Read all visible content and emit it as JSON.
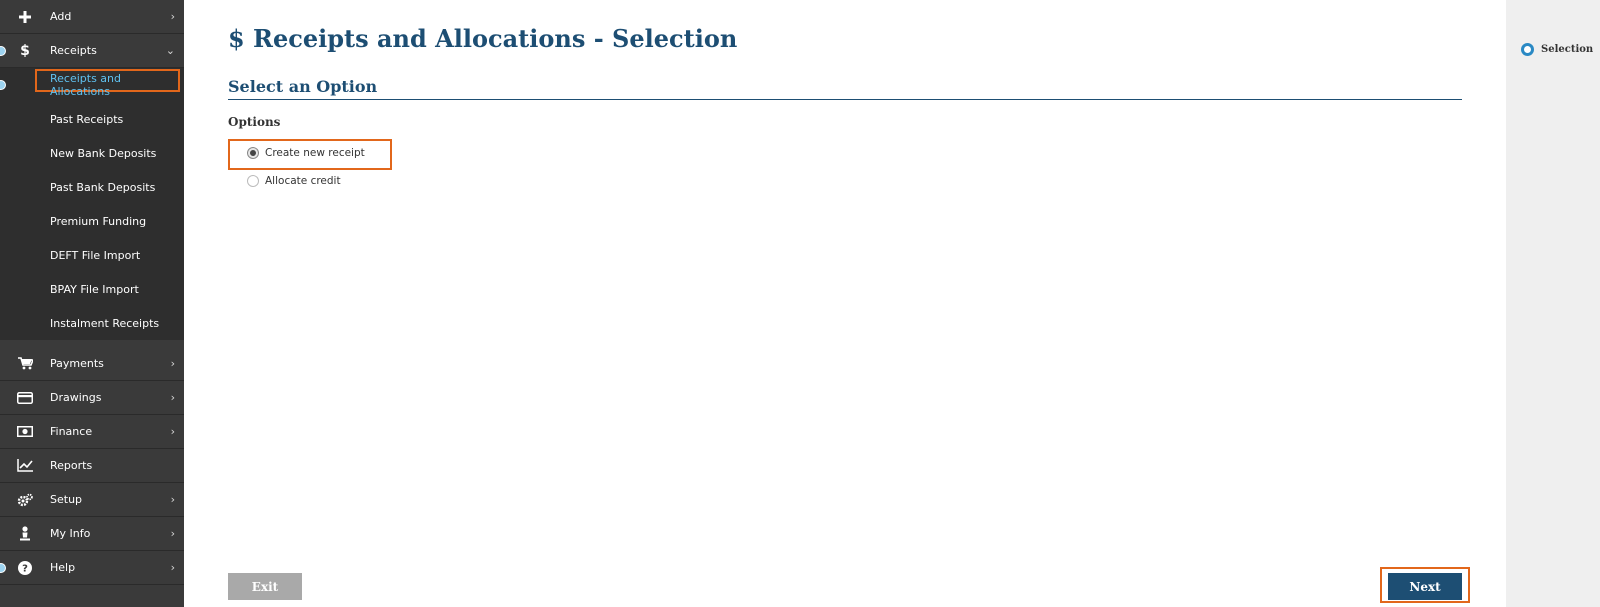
{
  "sidebar": {
    "items": [
      {
        "key": "add",
        "icon": "plus-icon",
        "label": "Add",
        "chevron": ">"
      },
      {
        "key": "receipts",
        "icon": "dollar-icon",
        "label": "Receipts",
        "chevron": "v"
      },
      {
        "key": "payments",
        "icon": "cart-icon",
        "label": "Payments",
        "chevron": ">"
      },
      {
        "key": "drawings",
        "icon": "card-icon",
        "label": "Drawings",
        "chevron": ">"
      },
      {
        "key": "finance",
        "icon": "cash-icon",
        "label": "Finance",
        "chevron": ">"
      },
      {
        "key": "reports",
        "icon": "chart-line-icon",
        "label": "Reports",
        "chevron": ""
      },
      {
        "key": "setup",
        "icon": "gears-icon",
        "label": "Setup",
        "chevron": ">"
      },
      {
        "key": "my_info",
        "icon": "person-icon",
        "label": "My Info",
        "chevron": ">"
      },
      {
        "key": "help",
        "icon": "help-icon",
        "label": "Help",
        "chevron": ">"
      }
    ],
    "receipts_sub": [
      {
        "label": "Receipts and Allocations",
        "active": true
      },
      {
        "label": "Past Receipts"
      },
      {
        "label": "New Bank Deposits"
      },
      {
        "label": "Past Bank Deposits"
      },
      {
        "label": "Premium Funding"
      },
      {
        "label": "DEFT File Import"
      },
      {
        "label": "BPAY File Import"
      },
      {
        "label": "Instalment Receipts"
      }
    ]
  },
  "main": {
    "title": "$ Receipts and Allocations - Selection",
    "section_title": "Select an Option",
    "options_label": "Options",
    "options": [
      {
        "label": "Create new receipt",
        "selected": true
      },
      {
        "label": "Allocate credit",
        "selected": false
      }
    ],
    "exit_label": "Exit",
    "next_label": "Next"
  },
  "steps": [
    {
      "label": "Selection"
    }
  ],
  "colors": {
    "brand": "#1d4e73",
    "highlight": "#e2671b",
    "active_link": "#5fc1f0",
    "sidebar_bg": "#3a3a3a",
    "rail_bg": "#efefef"
  }
}
